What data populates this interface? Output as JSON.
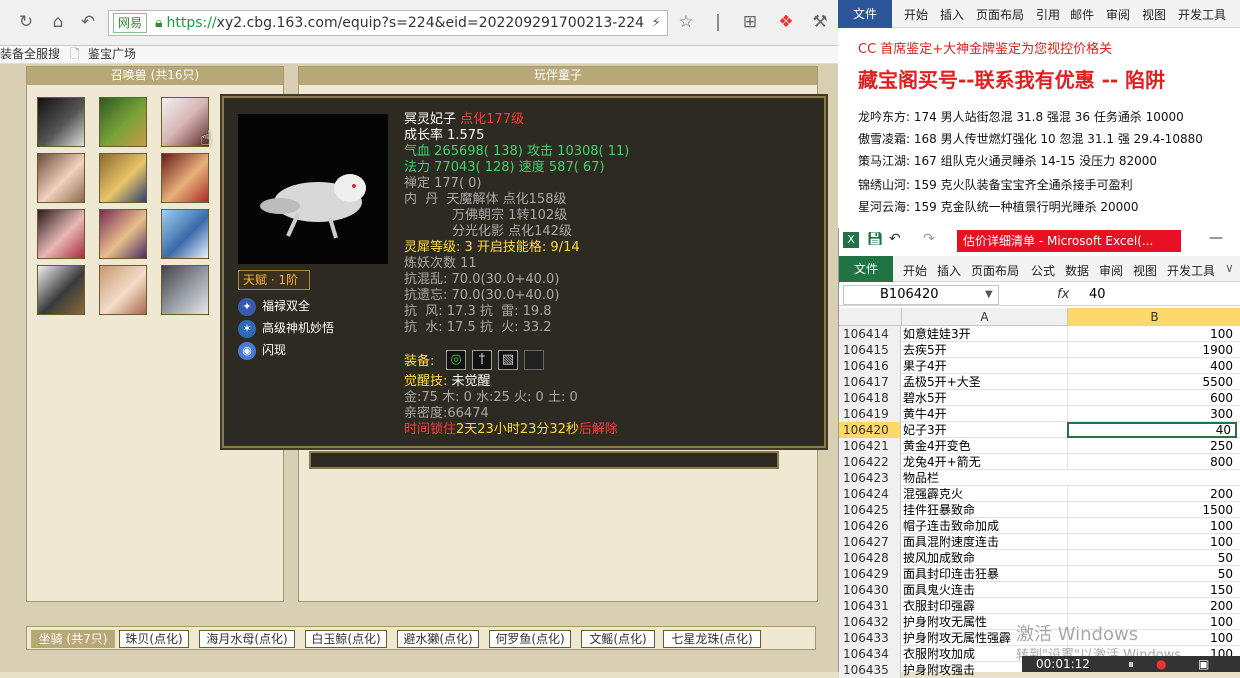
{
  "browser": {
    "url_badge": "网易",
    "url_proto": "https://",
    "url_rest": "xy2.cbg.163.com/equip?s=224&eid=202209291700213-224",
    "bookmarks": [
      "装备全服搜",
      "鉴宝广场"
    ]
  },
  "left_panel": {
    "title": "召唤兽 (共16只)"
  },
  "right_panel": {
    "title": "玩伴童子"
  },
  "pet": {
    "name": "冥灵妃子",
    "level": "点化177级",
    "growth": "成长率 1.575",
    "hp_label": "气血",
    "hp_value": "265698( 138)",
    "atk_label": "攻击",
    "atk_value": "10308( 11)",
    "mp_label": "法力",
    "mp_value": "77043( 128)",
    "spd_label": "速度",
    "spd_value": "587( 67)",
    "chanding": "禅定 177( 0)",
    "neidan_label": "内  丹",
    "neidan_1": "天魔解体 点化158级",
    "neidan_2": "万佛朝宗 1转102级",
    "neidan_3": "分光化影 点化142级",
    "lingxi": "灵犀等级: 3 开启技能格: 9/14",
    "lianyao": "炼妖次数 11",
    "kang_1": "抗混乱: 70.0(30.0+40.0)",
    "kang_2": "抗遗忘: 70.0(30.0+40.0)",
    "kang_3": "抗  风: 17.3 抗  雷: 19.8",
    "kang_4": "抗  水: 17.5 抗  火: 33.2",
    "equip_label": "装备:",
    "awaken_label": "觉醒技:",
    "awaken_value": "未觉醒",
    "elements": "金:75 木: 0 水:25 火: 0 土: 0",
    "intimacy": "亲密度:66474",
    "time_label": "时间锁住",
    "time_value": "2天23小时23分32秒",
    "time_suffix": "后解除",
    "talent": "天赋 · 1阶",
    "skills": [
      "福禄双全",
      "高级神机妙悟",
      "闪现"
    ]
  },
  "bottom_tabs": [
    "坐骑 (共7只)",
    "珠贝(点化)",
    "海月水母(点化)",
    "白玉鲸(点化)",
    "避水獭(点化)",
    "何罗鱼(点化)",
    "文鳐(点化)",
    "七星龙珠(点化)"
  ],
  "word": {
    "file_tab": "文件",
    "tabs": [
      "开始",
      "插入",
      "页面布局",
      "引用",
      "邮件",
      "审阅",
      "视图",
      "开发工具"
    ],
    "line_red": "CC 首席鉴定+大神金牌鉴定为您视控价格关",
    "headline": "藏宝阁买号--联系我有优惠 -- 陷阱",
    "lines": [
      "龙吟东方: 174 男人站街忽混 31.8 强混 36 任务通杀 10000",
      "傲雪凌霜: 168 男人传世燃灯强化 10 忽混 31.1 强 29.4-10880",
      "策马江湖: 167 组队克火通灵睡杀 14-15 没压力 82000",
      "锦绣山河: 159 克火队装备宝宝齐全通杀接手可盈利",
      "星河云海: 159 克金队统一种植景行明光睡杀 20000"
    ]
  },
  "excel": {
    "title": "估价详细清单 - Microsoft Excel(...",
    "file_tab": "文件",
    "tabs": [
      "开始",
      "插入",
      "页面布局",
      "公式",
      "数据",
      "审阅",
      "视图",
      "开发工具"
    ],
    "name_box": "B106420",
    "fx": "fx",
    "formula_value": "40",
    "col_a": "A",
    "col_b": "B",
    "rows": [
      {
        "n": "106414",
        "a": "如意娃娃3开",
        "b": "100"
      },
      {
        "n": "106415",
        "a": "去疾5开",
        "b": "1900"
      },
      {
        "n": "106416",
        "a": "果子4开",
        "b": "400"
      },
      {
        "n": "106417",
        "a": "孟极5开+大圣",
        "b": "5500"
      },
      {
        "n": "106418",
        "a": "碧水5开",
        "b": "600"
      },
      {
        "n": "106419",
        "a": "黄牛4开",
        "b": "300"
      },
      {
        "n": "106420",
        "a": "妃子3开",
        "b": "40"
      },
      {
        "n": "106421",
        "a": "黄金4开变色",
        "b": "250"
      },
      {
        "n": "106422",
        "a": "龙兔4开+箭无",
        "b": "800"
      },
      {
        "n": "106423",
        "a": "物品栏",
        "b": ""
      },
      {
        "n": "106424",
        "a": "混强霹克火",
        "b": "200"
      },
      {
        "n": "106425",
        "a": "挂件狂暴致命",
        "b": "1500"
      },
      {
        "n": "106426",
        "a": "帽子连击致命加成",
        "b": "100"
      },
      {
        "n": "106427",
        "a": "面具混附速度连击",
        "b": "100"
      },
      {
        "n": "106428",
        "a": "披风加成致命",
        "b": "50"
      },
      {
        "n": "106429",
        "a": "面具封印连击狂暴",
        "b": "50"
      },
      {
        "n": "106430",
        "a": "面具鬼火连击",
        "b": "150"
      },
      {
        "n": "106431",
        "a": "衣服封印强霹",
        "b": "200"
      },
      {
        "n": "106432",
        "a": "护身附攻无属性",
        "b": "100"
      },
      {
        "n": "106433",
        "a": "护身附攻无属性强霹",
        "b": "100"
      },
      {
        "n": "106434",
        "a": "衣服附攻加成",
        "b": "100"
      },
      {
        "n": "106435",
        "a": "护身附攻强击",
        "b": ""
      }
    ]
  },
  "overlay": {
    "watermark_1": "激活 Windows",
    "watermark_2": "转到\"设置\"以激活 Windows。",
    "timer": "00:01:12"
  },
  "colors": {
    "tooltip_bg": "#2d2a22",
    "excel_green": "#217346",
    "word_blue": "#2b579a",
    "title_red": "#e81123"
  }
}
